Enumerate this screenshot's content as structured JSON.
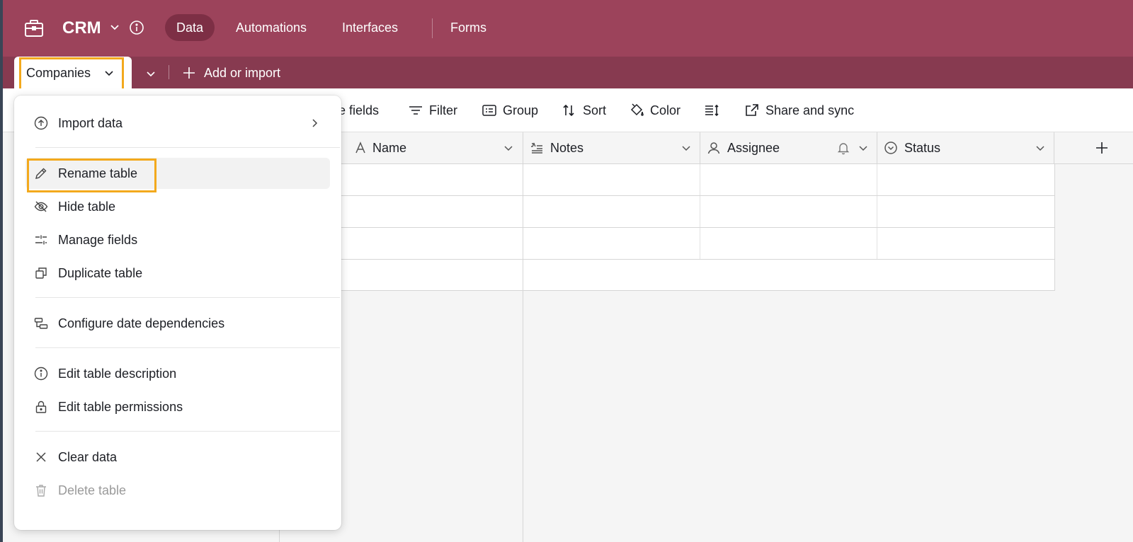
{
  "header": {
    "base_name": "CRM",
    "icons": {
      "base": "briefcase-icon",
      "chevron": "chevron-down-icon",
      "info": "info-icon"
    },
    "nav_tabs": [
      {
        "label": "Data",
        "active": true
      },
      {
        "label": "Automations",
        "active": false
      },
      {
        "label": "Interfaces",
        "active": false
      },
      {
        "label": "Forms",
        "active": false
      }
    ],
    "colors": {
      "header_bg": "#9c435b",
      "tabbar_bg": "#873a50",
      "highlight": "#f3a91d"
    }
  },
  "tabbar": {
    "active_table": "Companies",
    "add_import_label": "Add or import"
  },
  "toolbar": {
    "hide_fields_partial": "e fields",
    "filter": "Filter",
    "group": "Group",
    "sort": "Sort",
    "color": "Color",
    "share_sync": "Share and sync"
  },
  "grid": {
    "columns": [
      {
        "label": "Name",
        "icon": "text-a-icon"
      },
      {
        "label": "Notes",
        "icon": "long-text-icon"
      },
      {
        "label": "Assignee",
        "icon": "user-icon"
      },
      {
        "label": "Status",
        "icon": "circle-chevron-icon"
      }
    ]
  },
  "menu": {
    "items": [
      {
        "label": "Import data",
        "icon": "upload-circle-icon"
      },
      {
        "label": "Rename table",
        "icon": "pencil-icon"
      },
      {
        "label": "Hide table",
        "icon": "eye-off-icon"
      },
      {
        "label": "Manage fields",
        "icon": "sliders-icon"
      },
      {
        "label": "Duplicate table",
        "icon": "duplicate-icon"
      },
      {
        "label": "Configure date dependencies",
        "icon": "dependency-icon"
      },
      {
        "label": "Edit table description",
        "icon": "info-icon"
      },
      {
        "label": "Edit table permissions",
        "icon": "lock-icon"
      },
      {
        "label": "Clear data",
        "icon": "x-icon"
      },
      {
        "label": "Delete table",
        "icon": "trash-icon",
        "disabled": true
      }
    ]
  }
}
